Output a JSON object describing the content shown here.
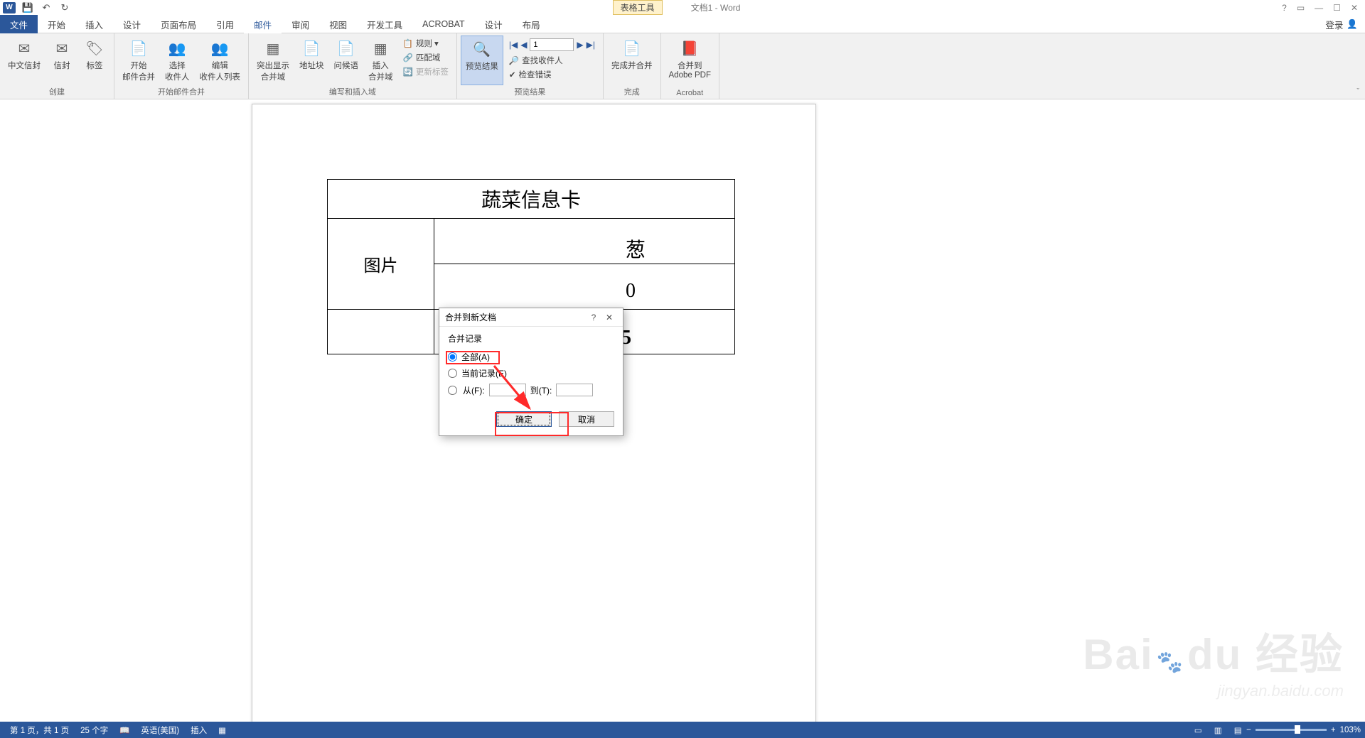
{
  "titlebar": {
    "context_tool": "表格工具",
    "doc_title": "文档1 - Word"
  },
  "tabs": {
    "file": "文件",
    "items": [
      "开始",
      "插入",
      "设计",
      "页面布局",
      "引用",
      "邮件",
      "审阅",
      "视图",
      "开发工具",
      "ACROBAT",
      "设计",
      "布局"
    ],
    "active_index": 5,
    "signin": "登录"
  },
  "ribbon": {
    "groups": {
      "create": {
        "label": "创建",
        "btns": [
          "中文信封",
          "信封",
          "标签"
        ]
      },
      "start_merge": {
        "label": "开始邮件合并",
        "btns": [
          "开始\n邮件合并",
          "选择\n收件人",
          "编辑\n收件人列表"
        ]
      },
      "write_insert": {
        "label": "编写和插入域",
        "btns": [
          "突出显示\n合并域",
          "地址块",
          "问候语",
          "插入\n合并域"
        ],
        "rules": "规则 ▾",
        "match": "匹配域",
        "update": "更新标签"
      },
      "preview": {
        "label": "预览结果",
        "btn": "预览结果",
        "record_value": "1",
        "find": "查找收件人",
        "check": "检查错误"
      },
      "finish": {
        "label": "完成",
        "btn": "完成并合并"
      },
      "acrobat": {
        "label": "Acrobat",
        "btn": "合并到\nAdobe PDF"
      }
    }
  },
  "document": {
    "title": "蔬菜信息卡",
    "image_label": "图片",
    "col2_partial1": "葱",
    "col2_partial2": "0",
    "row2_partial": "25"
  },
  "dialog": {
    "title": "合并到新文档",
    "section": "合并记录",
    "opt_all": "全部(A)",
    "opt_current": "当前记录(E)",
    "opt_from": "从(F):",
    "opt_to": "到(T):",
    "ok": "确定",
    "cancel": "取消"
  },
  "statusbar": {
    "page": "第 1 页，共 1 页",
    "words": "25 个字",
    "lang": "英语(美国)",
    "mode": "插入",
    "zoom": "103%"
  },
  "watermark": {
    "brand1": "Bai",
    "brand2": "经验",
    "url": "jingyan.baidu.com"
  }
}
